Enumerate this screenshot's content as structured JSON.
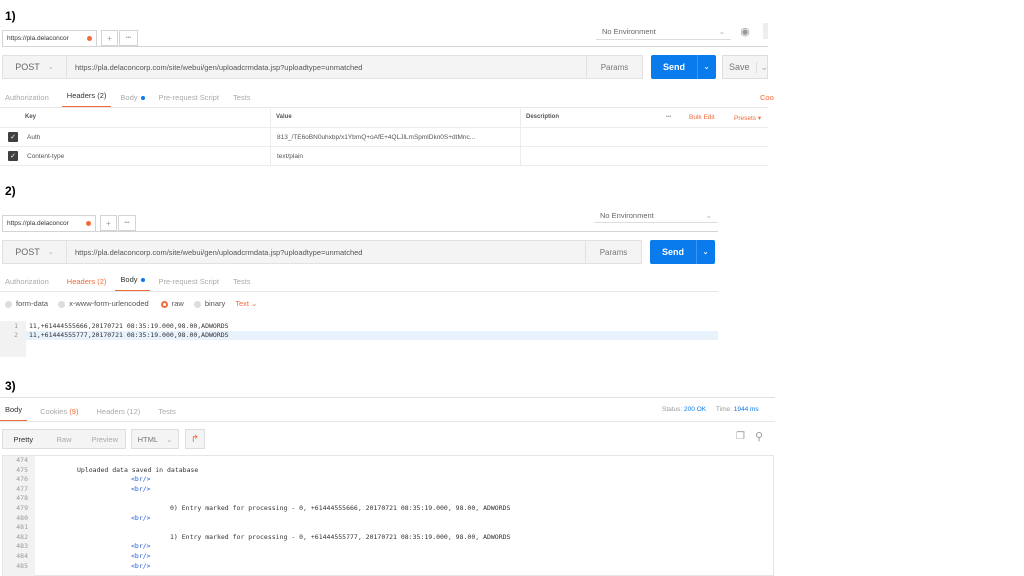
{
  "steps": {
    "s1": "1)",
    "s2": "2)",
    "s3": "3)"
  },
  "shared": {
    "tab_url": "https://pla.delaconcor",
    "add_tab": "+",
    "more_tabs": "•••",
    "environment": "No Environment",
    "method": "POST",
    "request_url": "https://pla.delaconcorp.com/site/webui/gen/uploadcrmdata.jsp?uploadtype=unmatched",
    "params": "Params",
    "send": "Send",
    "save": "Save",
    "tab_authorization": "Authorization",
    "tab_headers": "Headers (2)",
    "tab_body": "Body",
    "tab_prerequest": "Pre-request Script",
    "tab_tests": "Tests"
  },
  "panel1": {
    "cookies_code": "Coo",
    "table_headers": {
      "key": "Key",
      "value": "Value",
      "description": "Description"
    },
    "more": "•••",
    "bulk_edit": "Bulk Edit",
    "presets": "Presets ▾",
    "rows": [
      {
        "key": "Auth",
        "value": "813_/TE6oBN0uhxbp/x1YbmQ+oAfE+4QLJlLmSpmlDkn0S+dtMnc..."
      },
      {
        "key": "Content-type",
        "value": "text/plain"
      }
    ]
  },
  "panel2": {
    "body_types": [
      "form-data",
      "x-www-form-urlencoded",
      "raw",
      "binary"
    ],
    "text_mode": "Text",
    "lines": [
      {
        "num": "1",
        "text": "11,+61444555666,20170721 08:35:19.000,98.00,ADWORDS"
      },
      {
        "num": "2",
        "text": "11,+61444555777,20170721 08:35:19.000,98.00,ADWORDS"
      }
    ]
  },
  "panel3": {
    "tabs": {
      "body": "Body",
      "cookies": "Cookies",
      "cookies_count": "(9)",
      "headers": "Headers (12)",
      "tests": "Tests"
    },
    "status_label": "Status:",
    "status_value": "200 OK",
    "time_label": "Time:",
    "time_value": "1944 ms",
    "views": [
      "Pretty",
      "Raw",
      "Preview"
    ],
    "format": "HTML",
    "lines": [
      {
        "num": "474",
        "text": ""
      },
      {
        "num": "475",
        "text": "Uploaded data saved in database"
      },
      {
        "num": "476",
        "text": "<br/>"
      },
      {
        "num": "477",
        "text": "<br/>"
      },
      {
        "num": "478",
        "text": ""
      },
      {
        "num": "479",
        "text": "0) Entry marked for processing - 0, +61444555666, 20170721 08:35:19.000, 98.00, ADWORDS"
      },
      {
        "num": "480",
        "text": "<br/>"
      },
      {
        "num": "481",
        "text": ""
      },
      {
        "num": "482",
        "text": "1) Entry marked for processing - 0, +61444555777, 20170721 08:35:19.000, 98.00, ADWORDS"
      },
      {
        "num": "483",
        "text": "<br/>"
      },
      {
        "num": "484",
        "text": "<br/>"
      },
      {
        "num": "485",
        "text": "<br/>"
      }
    ]
  },
  "colors": {
    "accent": "#f26b3a",
    "send": "#097bed",
    "status_ok": "#097bed"
  }
}
